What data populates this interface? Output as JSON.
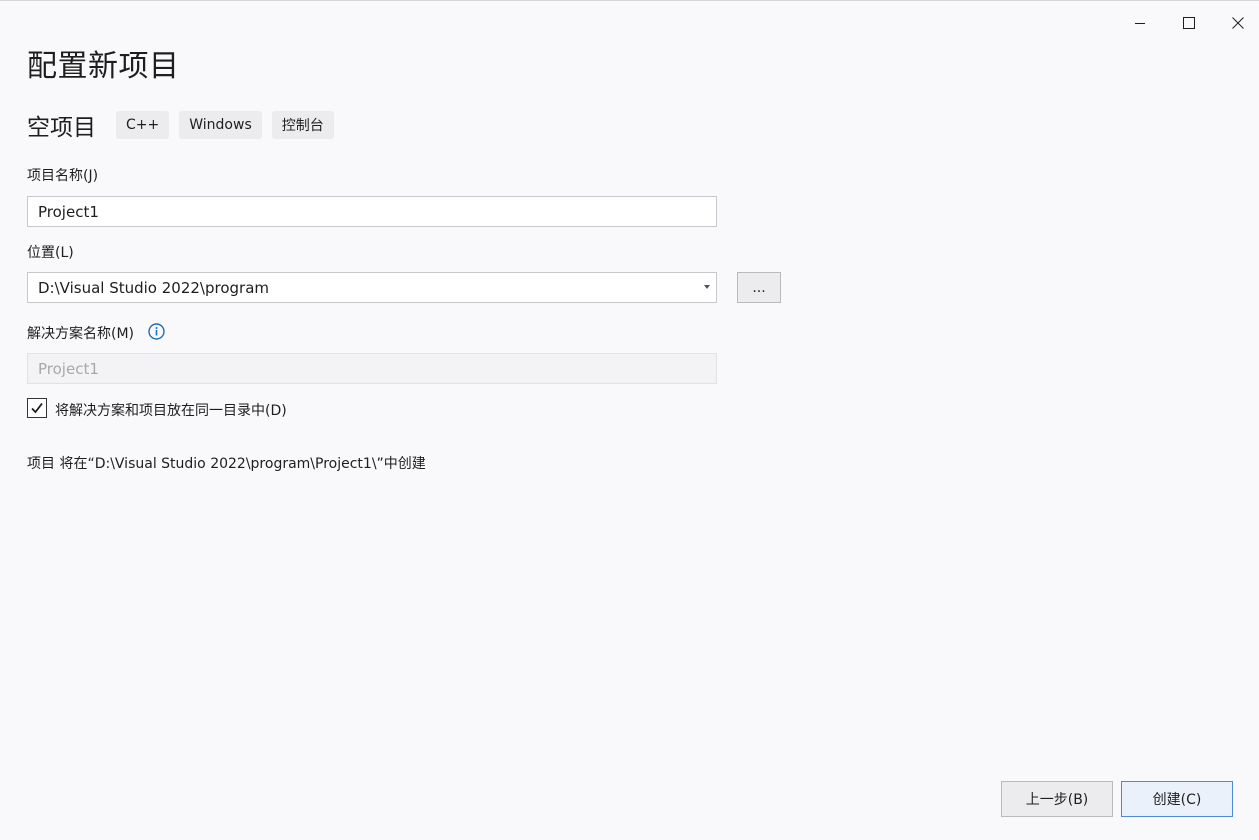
{
  "window": {
    "minimize_icon": "minimize-icon",
    "maximize_icon": "maximize-icon",
    "close_icon": "close-icon"
  },
  "page": {
    "title": "配置新项目"
  },
  "template": {
    "name": "空项目",
    "tags": [
      "C++",
      "Windows",
      "控制台"
    ]
  },
  "form": {
    "project_name_label": "项目名称(J)",
    "project_name_value": "Project1",
    "location_label": "位置(L)",
    "location_value": "D:\\Visual Studio 2022\\program",
    "browse_label": "...",
    "solution_name_label": "解决方案名称(M)",
    "solution_name_value": "Project1",
    "same_dir_label": "将解决方案和项目放在同一目录中(D)",
    "same_dir_checked": true,
    "summary": "项目 将在“D:\\Visual Studio 2022\\program\\Project1\\”中创建"
  },
  "footer": {
    "back_label": "上一步(B)",
    "create_label": "创建(C)"
  },
  "colors": {
    "background": "#f9f9fb",
    "info_icon": "#1c6fb0",
    "create_border": "#4f8ad9"
  }
}
